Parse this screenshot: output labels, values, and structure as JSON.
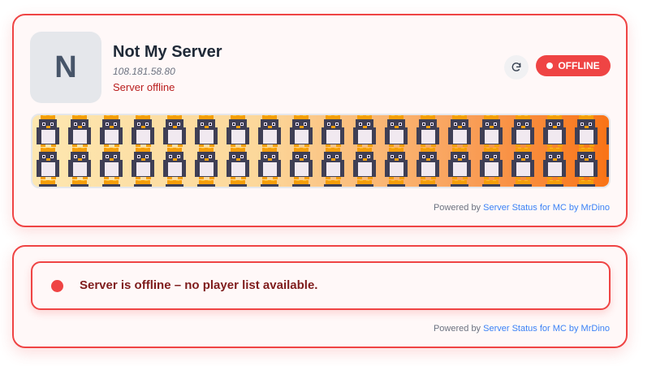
{
  "server": {
    "avatar_letter": "N",
    "name": "Not My Server",
    "ip": "108.181.58.80",
    "status_text": "Server offline"
  },
  "controls": {
    "refresh_icon": "refresh-icon",
    "badge_label": "OFFLINE"
  },
  "banner": {
    "icon": "penguin-pattern"
  },
  "players": {
    "message": "Server is offline – no player list available."
  },
  "footer": {
    "prefix": "Powered by",
    "link_text": "Server Status for MC by MrDino"
  },
  "colors": {
    "accent": "#ef4444",
    "link": "#3b82f6",
    "status_text": "#b91c1c"
  }
}
